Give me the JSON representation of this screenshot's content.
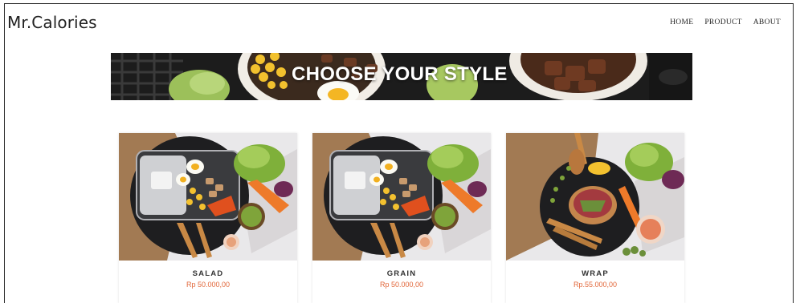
{
  "header": {
    "brand": "Mr.Calories",
    "nav": [
      {
        "label": "HOME"
      },
      {
        "label": "PRODUCT"
      },
      {
        "label": "ABOUT"
      }
    ]
  },
  "hero": {
    "title": "CHOOSE YOUR STYLE"
  },
  "products": [
    {
      "name": "SALAD",
      "price": "Rp 50.000,00"
    },
    {
      "name": "GRAIN",
      "price": "Rp 50.000,00"
    },
    {
      "name": "WRAP",
      "price": "Rp.55.000,00"
    }
  ],
  "colors": {
    "price": "#e2673a",
    "text": "#222222",
    "banner_dark": "#1b1b1b"
  }
}
